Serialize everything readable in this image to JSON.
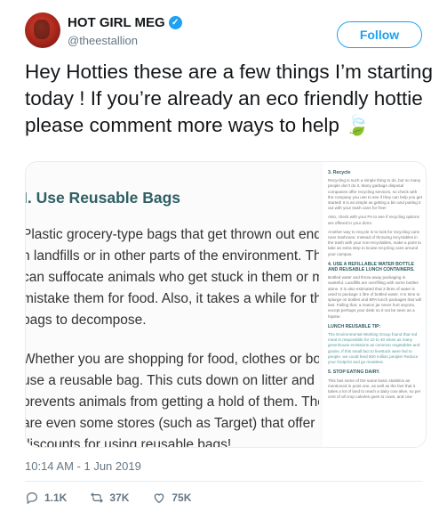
{
  "header": {
    "display_name": "HOT GIRL MEG",
    "handle": "@theestallion",
    "follow_label": "Follow",
    "verified_check": "✓"
  },
  "tweet": {
    "text": "Hey Hotties these are a few things I’m starting today ! If you’re already an eco friendly hottie please comment more ways to help",
    "emoji": "🍃",
    "timestamp": "10:14 AM - 1 Jun 2019"
  },
  "media": {
    "left_doc": {
      "heading": "I. Use Reusable Bags",
      "paragraphs": [
        "Plastic grocery-type bags that get thrown out end up",
        "n landfills or in other parts of the environment. These",
        "can suffocate animals who get stuck in them or may",
        "mistake them for food. Also, it takes a while for the",
        "bags to decompose.",
        "Whether you are shopping for food, clothes or books",
        "use a reusable bag. This cuts down on litter and",
        "prevents animals from getting a hold of them. There",
        "are even some stores (such as Target) that offer",
        "discounts for using reusable bags!"
      ]
    },
    "right_doc": {
      "h1": "3. Recycle",
      "p1": "Recycling is such a simple thing to do, but so many people don’t do it. Many garbage disposal companies offer recycling services, so check with the company you use to see if they can help you get started! It is as simple as getting a bin and putting it out with your trash cans for free!",
      "p2": "Also, check with your PA to see if recycling options are offered in your dorm.",
      "p3": "Another way to recycle is to look for recycling cans near trashcans. Instead of throwing recyclables in the trash with your non-recyclables, make a point to take an extra step to locate recycling cans around your campus.",
      "h2": "4. USE A REFILLABLE WATER BOTTLE AND REUSABLE LUNCH CONTAINERS.",
      "p4": "Bottled water and throw away packaging is wasteful. Landfills are overfilling with some bottles alone. It is also estimated that 3 litres of water is used to package 1 litre of bottled water. It is time to splurge on bottles and BPA lunch packages that will last. Failing that, a mason jar never hurt anyone, except perhaps your desk so it not be seen as a hipster.",
      "h3": "LUNCH REUSABLE TIP:",
      "p5": "The Environmental Working Group found that red meat is responsible for 10 to 40 times as many greenhouse emissions as common vegetables and grains. If this small fact to livestock were fed to people, we could feed 800 million people! Reduce your footprint and go meatless.",
      "h4": "5. STOP EATING DAIRY.",
      "p6": "This has some of the same basic statistics as mentioned in point one, as well as the fact that it takes a lot of land to reach a dairy cow alive, so per cent of all crop calories goes to cows, and cow"
    }
  },
  "actions": {
    "replies": "1.1K",
    "retweets": "37K",
    "likes": "75K"
  },
  "colors": {
    "accent": "#1da1f2",
    "secondary_text": "#657786",
    "doc_heading": "#2f5f63"
  }
}
